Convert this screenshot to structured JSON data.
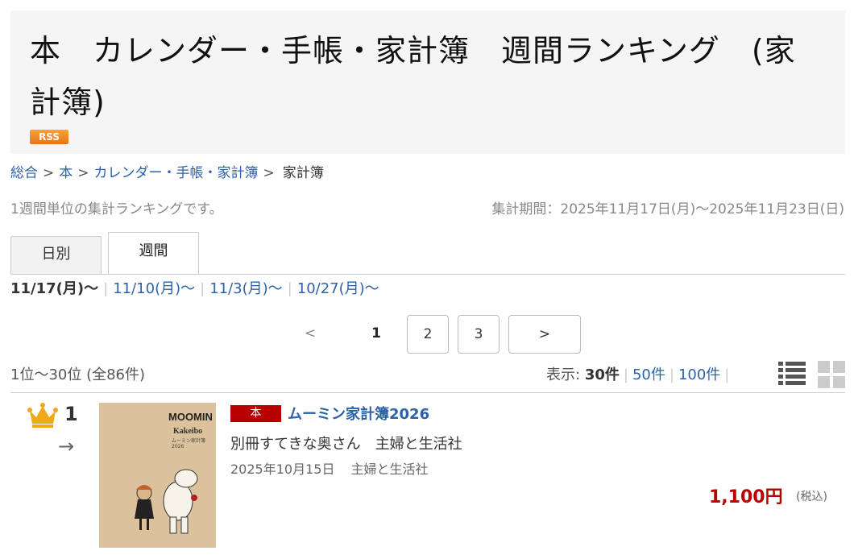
{
  "header": {
    "title": "本　カレンダー・手帳・家計簿　週間ランキング　(家計簿)",
    "rss_label": "RSS"
  },
  "breadcrumb": {
    "items": [
      "総合",
      "本",
      "カレンダー・手帳・家計簿"
    ],
    "separator": ">",
    "current": "家計簿"
  },
  "info": {
    "description": "1週間単位の集計ランキングです。",
    "period": "集計期間：2025年11月17日(月)〜2025年11月23日(日)"
  },
  "tabs": [
    {
      "label": "日別",
      "active": false
    },
    {
      "label": "週間",
      "active": true
    }
  ],
  "weeks": {
    "active": "11/17(月)〜",
    "links": [
      "11/10(月)〜",
      "11/3(月)〜",
      "10/27(月)〜"
    ]
  },
  "pager": {
    "prev": "<",
    "current": "1",
    "pages": [
      "2",
      "3"
    ],
    "next": ">"
  },
  "results": {
    "range": "1位〜30位 (全86件)",
    "display_label": "表示:",
    "display_options": [
      "30件",
      "50件",
      "100件"
    ],
    "display_selected": "30件"
  },
  "view_icons": [
    "list-view-icon",
    "grid-view-icon"
  ],
  "items": [
    {
      "rank": "1",
      "rank_change": "→",
      "category": "本",
      "title": "ムーミン家計簿2026",
      "author": "別冊すてきな奥さん　主婦と生活社",
      "release_date": "2025年10月15日",
      "publisher": "主婦と生活社",
      "price": "1,100円",
      "tax_note": "(税込)",
      "cover": {
        "logo": "MOOMIN",
        "subtitle": "Kakeibo",
        "small": "ムーミン家計簿 2026"
      }
    }
  ],
  "colors": {
    "link": "#2b62a8",
    "price": "#b80000",
    "badge": "#b80000",
    "crown": "#f0a818",
    "rss": "#f08a24"
  }
}
